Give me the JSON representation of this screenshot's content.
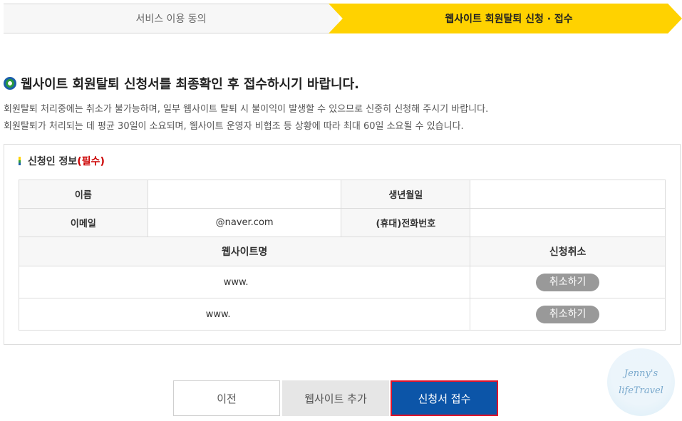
{
  "steps": {
    "step1": "서비스 이용 동의",
    "step2": "웹사이트 회원탈퇴 신청 · 접수"
  },
  "heading": "웹사이트 회원탈퇴 신청서를 최종확인 후 접수하시기 바랍니다.",
  "desc": {
    "line1": "회원탈퇴 처리중에는 취소가 불가능하며, 일부 웹사이트 탈퇴 시 불이익이 발생할 수 있으므로 신중히 신청해 주시기 바랍니다.",
    "line2": "회원탈퇴가 처리되는 데 평균 30일이 소요되며, 웹사이트 운영자 비협조 등 상황에 따라 최대 60일 소요될 수 있습니다."
  },
  "applicant": {
    "title": "신청인 정보",
    "required": "(필수)",
    "name_label": "이름",
    "name_value": "",
    "birth_label": "생년월일",
    "birth_value": "",
    "email_label": "이메일",
    "email_value": "@naver.com",
    "phone_label": "(휴대)전화번호",
    "phone_value": ""
  },
  "sites": {
    "col_site": "웹사이트명",
    "col_cancel": "신청취소",
    "rows": [
      {
        "site": "www.",
        "cancel": "취소하기"
      },
      {
        "site": "www.",
        "cancel": "취소하기"
      }
    ]
  },
  "buttons": {
    "prev": "이전",
    "add": "웹사이트 추가",
    "submit": "신청서 접수"
  },
  "watermark": {
    "line1": "Jenny's",
    "line2": "lifeTravel"
  }
}
